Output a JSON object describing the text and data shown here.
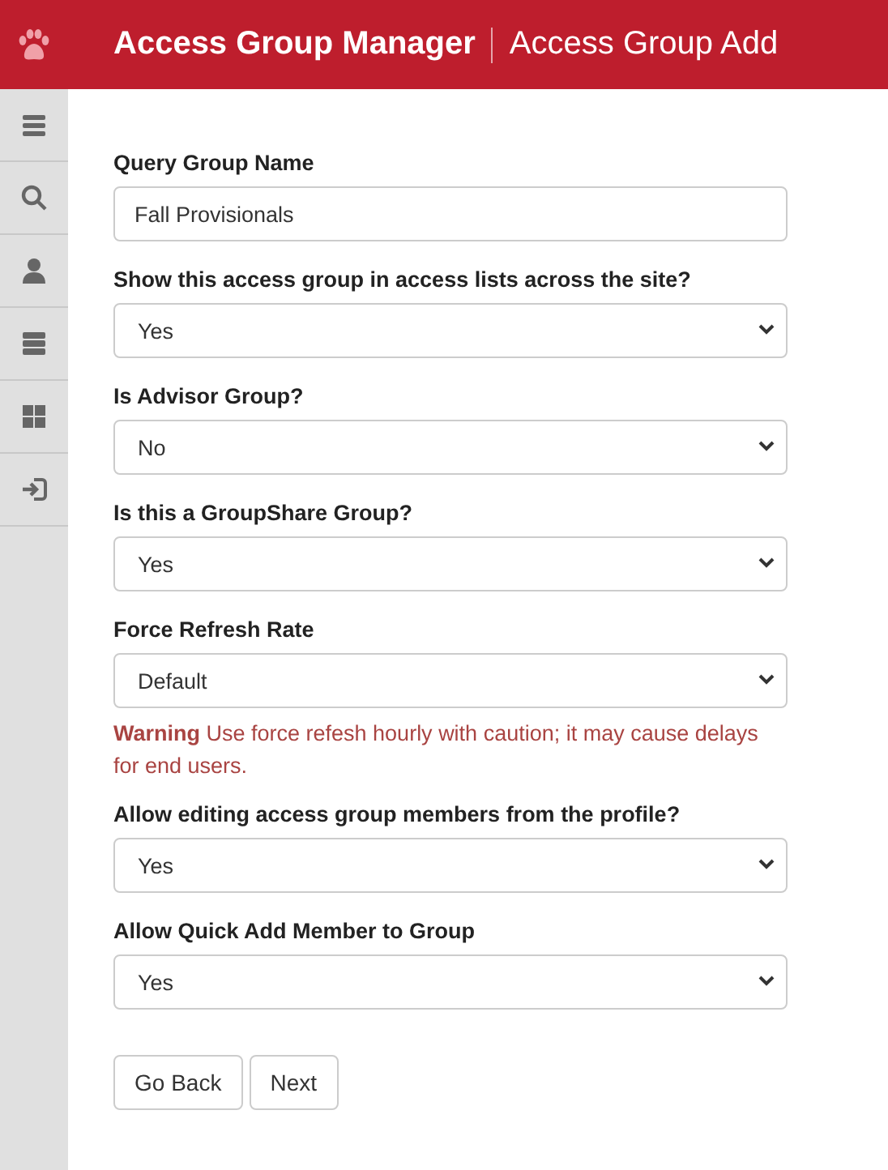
{
  "header": {
    "app_title": "Access Group Manager",
    "page_title": "Access Group Add"
  },
  "fields": [
    {
      "label": "Query Group Name",
      "kind": "text",
      "value": "Fall Provisionals"
    },
    {
      "label": "Show this access group in access lists across the site?",
      "kind": "select",
      "value": "Yes"
    },
    {
      "label": "Is Advisor Group?",
      "kind": "select",
      "value": "No"
    },
    {
      "label": "Is this a GroupShare Group?",
      "kind": "select",
      "value": "Yes"
    },
    {
      "label": "Force Refresh Rate",
      "kind": "select",
      "value": "Default",
      "note": "**Warning** Use force refesh hourly with caution; it may cause delays for end users."
    },
    {
      "label": "Allow editing access group members from the profile?",
      "kind": "select",
      "value": "Yes"
    },
    {
      "label": "Allow Quick Add Member to Group",
      "kind": "select",
      "value": "Yes"
    }
  ],
  "buttons": [
    "Go Back",
    "Next"
  ]
}
